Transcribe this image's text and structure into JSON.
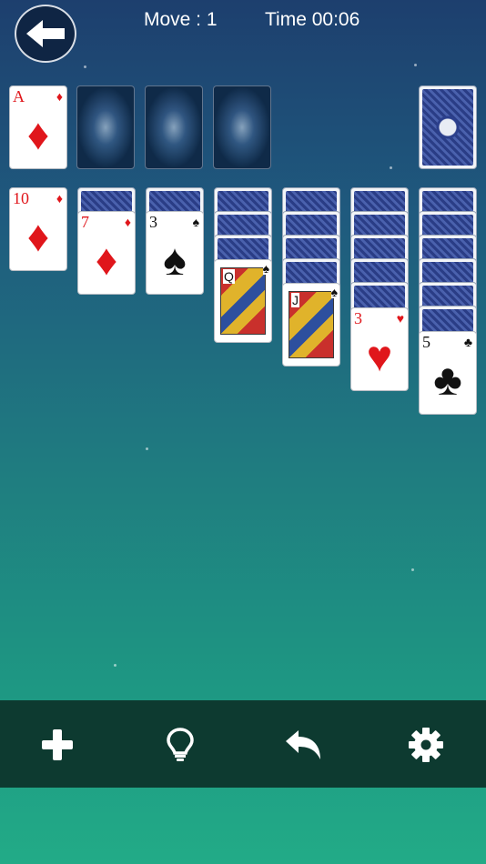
{
  "hud": {
    "move_label": "Move : 1",
    "time_label": "Time 00:06"
  },
  "foundations": [
    {
      "rank": "A",
      "suit": "♦",
      "color": "red"
    }
  ],
  "stock": {
    "state": "face-down"
  },
  "tableau": [
    {
      "hidden": 0,
      "face": [
        {
          "rank": "10",
          "suit": "♦",
          "color": "red"
        }
      ]
    },
    {
      "hidden": 1,
      "face": [
        {
          "rank": "7",
          "suit": "♦",
          "color": "red"
        }
      ]
    },
    {
      "hidden": 1,
      "face": [
        {
          "rank": "3",
          "suit": "♠",
          "color": "blk"
        }
      ]
    },
    {
      "hidden": 3,
      "face": [
        {
          "rank": "Q",
          "suit": "♠",
          "color": "blk",
          "court": true
        }
      ]
    },
    {
      "hidden": 4,
      "face": [
        {
          "rank": "J",
          "suit": "♠",
          "color": "blk",
          "court": true
        }
      ]
    },
    {
      "hidden": 5,
      "face": [
        {
          "rank": "3",
          "suit": "♥",
          "color": "red"
        }
      ]
    },
    {
      "hidden": 6,
      "face": [
        {
          "rank": "5",
          "suit": "♣",
          "color": "blk"
        }
      ]
    }
  ],
  "toolbar": {
    "icons": [
      "plus-icon",
      "lightbulb-icon",
      "undo-icon",
      "gear-icon"
    ],
    "accent": "#0d3a30"
  }
}
